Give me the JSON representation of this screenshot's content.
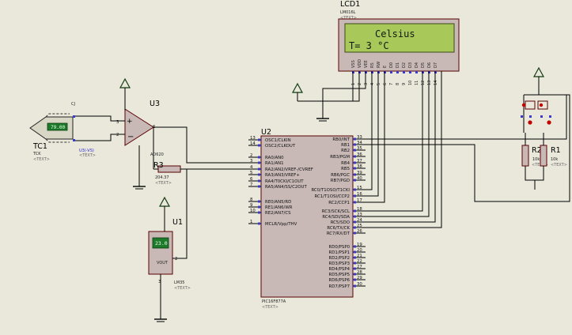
{
  "lcd": {
    "ref": "LCD1",
    "part": "LM016L",
    "text_tag": "<TEXT>",
    "line1": "Celsius",
    "line2": "T= 3  °C",
    "pin_labels": [
      "VSS",
      "VDD",
      "VEE",
      "RS",
      "RW",
      "E",
      "D0",
      "D1",
      "D2",
      "D3",
      "D4",
      "D5",
      "D6",
      "D7"
    ],
    "pin_numbers": [
      "1",
      "2",
      "3",
      "4",
      "5",
      "6",
      "7",
      "8",
      "9",
      "10",
      "11",
      "12",
      "13",
      "14"
    ]
  },
  "mcu": {
    "ref": "U2",
    "part": "PIC16F877A",
    "text_tag": "<TEXT>",
    "left_pins": [
      {
        "num": "13",
        "name": "OSC1/CLKIN"
      },
      {
        "num": "14",
        "name": "OSC2/CLKOUT"
      },
      {
        "num": "2",
        "name": "RA0/AN0"
      },
      {
        "num": "3",
        "name": "RA1/AN1"
      },
      {
        "num": "4",
        "name": "RA2/AN2/VREF-/CVREF"
      },
      {
        "num": "5",
        "name": "RA3/AN3/VREF+"
      },
      {
        "num": "6",
        "name": "RA4/T0CKI/C1OUT"
      },
      {
        "num": "7",
        "name": "RA5/AN4/SS/C2OUT"
      },
      {
        "num": "8",
        "name": "RE0/AN5/RD"
      },
      {
        "num": "9",
        "name": "RE1/AN6/WR"
      },
      {
        "num": "10",
        "name": "RE2/AN7/CS"
      },
      {
        "num": "1",
        "name": "MCLR/Vpp/THV"
      }
    ],
    "right_pins": [
      {
        "num": "33",
        "name": "RB0/INT"
      },
      {
        "num": "34",
        "name": "RB1"
      },
      {
        "num": "35",
        "name": "RB2"
      },
      {
        "num": "36",
        "name": "RB3/PGM"
      },
      {
        "num": "37",
        "name": "RB4"
      },
      {
        "num": "38",
        "name": "RB5"
      },
      {
        "num": "39",
        "name": "RB6/PGC"
      },
      {
        "num": "40",
        "name": "RB7/PGD"
      },
      {
        "num": "15",
        "name": "RC0/T1OSO/T1CKI"
      },
      {
        "num": "16",
        "name": "RC1/T1OSI/CCP2"
      },
      {
        "num": "17",
        "name": "RC2/CCP1"
      },
      {
        "num": "18",
        "name": "RC3/SCK/SCL"
      },
      {
        "num": "23",
        "name": "RC4/SDI/SDA"
      },
      {
        "num": "24",
        "name": "RC5/SDO"
      },
      {
        "num": "25",
        "name": "RC6/TX/CK"
      },
      {
        "num": "26",
        "name": "RC7/RX/DT"
      },
      {
        "num": "19",
        "name": "RD0/PSP0"
      },
      {
        "num": "20",
        "name": "RD1/PSP1"
      },
      {
        "num": "21",
        "name": "RD2/PSP2"
      },
      {
        "num": "22",
        "name": "RD3/PSP3"
      },
      {
        "num": "27",
        "name": "RD4/PSP4"
      },
      {
        "num": "28",
        "name": "RD5/PSP5"
      },
      {
        "num": "29",
        "name": "RD6/PSP6"
      },
      {
        "num": "30",
        "name": "RD7/PSP7"
      }
    ]
  },
  "thermocouple": {
    "ref": "TC1",
    "part": "TCK",
    "text_tag": "<TEXT>",
    "reading": "79.00",
    "cj_label": "CJ"
  },
  "amp": {
    "ref": "U3",
    "part": "AD620",
    "pin_plus": "3",
    "pin_minus": "2",
    "pin_out": "6",
    "net_label": "U3(-VS)",
    "text_tag": "<TEXT>"
  },
  "r3": {
    "ref": "R3",
    "value": "204.37",
    "text_tag": "<TEXT>"
  },
  "lm35": {
    "ref": "U1",
    "part": "LM35",
    "reading": "23.0",
    "pin_label": "VOUT",
    "pin_vout": "2",
    "pin_gnd": "3",
    "text_tag": "<TEXT>"
  },
  "r2": {
    "ref": "R2",
    "value": "10k",
    "text_tag": "<TEXT>"
  },
  "r1": {
    "ref": "R1",
    "value": "10k",
    "text_tag": "<TEXT>"
  },
  "colors": {
    "background": "#e9e8db",
    "component_body": "#c8b9b7",
    "component_outline": "#5a0000",
    "lcd_screen": "#a8c85a",
    "wire": "#000000",
    "power_arrow": "#123a12",
    "pin_dot_blue": "#3a3ad0",
    "pin_dot_red": "#c00000",
    "display_green": "#1c7a2a"
  }
}
